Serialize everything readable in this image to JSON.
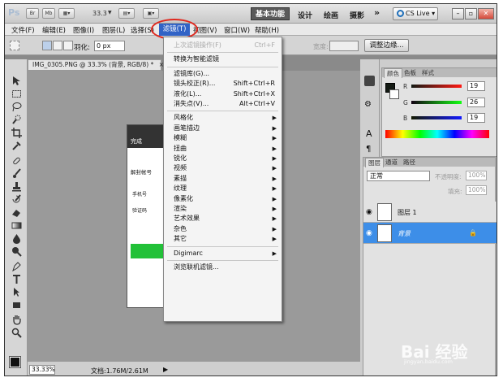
{
  "app_bar": {
    "logo": "Ps",
    "btn_br": "Br",
    "btn_mb": "Mb",
    "zoom": "33.3",
    "workspace_active": "基本功能",
    "workspaces": [
      "设计",
      "绘画",
      "摄影"
    ],
    "more": "»",
    "cs_live": "CS Live"
  },
  "menu_bar": {
    "items": [
      "文件(F)",
      "编辑(E)",
      "图像(I)",
      "图层(L)",
      "选择(S)",
      "滤镜(T)",
      "视图(V)",
      "窗口(W)",
      "帮助(H)"
    ],
    "active": "滤镜(T)"
  },
  "options_bar": {
    "feather_label": "羽化:",
    "feather_value": "0 px",
    "width_label": "宽度:",
    "adjust_edge": "调整边缘..."
  },
  "document": {
    "tab_title": "IMG_0305.PNG @ 33.3% (背景, RGB/8) *",
    "content_lines": [
      "完成",
      "解封帐号",
      "手机号",
      "验证码"
    ],
    "status_zoom": "33.33%",
    "status_doc": "文档:1.76M/2.61M"
  },
  "filter_menu": {
    "items": [
      {
        "label": "上次滤镜操作(F)",
        "shortcut": "Ctrl+F",
        "disabled": true
      },
      {
        "sep": true
      },
      {
        "label": "转换为智能滤镜"
      },
      {
        "sep": true
      },
      {
        "label": "滤镜库(G)..."
      },
      {
        "label": "镜头校正(R)...",
        "shortcut": "Shift+Ctrl+R"
      },
      {
        "label": "液化(L)...",
        "shortcut": "Shift+Ctrl+X"
      },
      {
        "label": "消失点(V)...",
        "shortcut": "Alt+Ctrl+V"
      },
      {
        "sep": true
      },
      {
        "label": "风格化",
        "submenu": true
      },
      {
        "label": "画笔描边",
        "submenu": true
      },
      {
        "label": "模糊",
        "submenu": true
      },
      {
        "label": "扭曲",
        "submenu": true
      },
      {
        "label": "锐化",
        "submenu": true
      },
      {
        "label": "视频",
        "submenu": true
      },
      {
        "label": "素描",
        "submenu": true
      },
      {
        "label": "纹理",
        "submenu": true
      },
      {
        "label": "像素化",
        "submenu": true
      },
      {
        "label": "渲染",
        "submenu": true
      },
      {
        "label": "艺术效果",
        "submenu": true
      },
      {
        "label": "杂色",
        "submenu": true
      },
      {
        "label": "其它",
        "submenu": true
      },
      {
        "sep": true
      },
      {
        "label": "Digimarc",
        "submenu": true
      },
      {
        "sep": true
      },
      {
        "label": "浏览联机滤镜..."
      }
    ]
  },
  "color_panel": {
    "tabs": [
      "颜色",
      "色板",
      "样式"
    ],
    "r": "19",
    "g": "26",
    "b": "19"
  },
  "layers_panel": {
    "tabs": [
      "图层",
      "通道",
      "路径"
    ],
    "blend_mode": "正常",
    "opacity_label": "不透明度:",
    "opacity": "100%",
    "fill_label": "填充:",
    "fill": "100%",
    "layers": [
      {
        "name": "图层 1",
        "selected": false
      },
      {
        "name": "背景",
        "selected": true
      }
    ]
  },
  "watermark": {
    "main": "Bai 经验",
    "sub": "jingyan.baidu.com"
  },
  "colors": {
    "menu_highlight": "#3163c6",
    "layer_selected": "#3d8ee8",
    "annotation_ring": "#e0281e"
  }
}
